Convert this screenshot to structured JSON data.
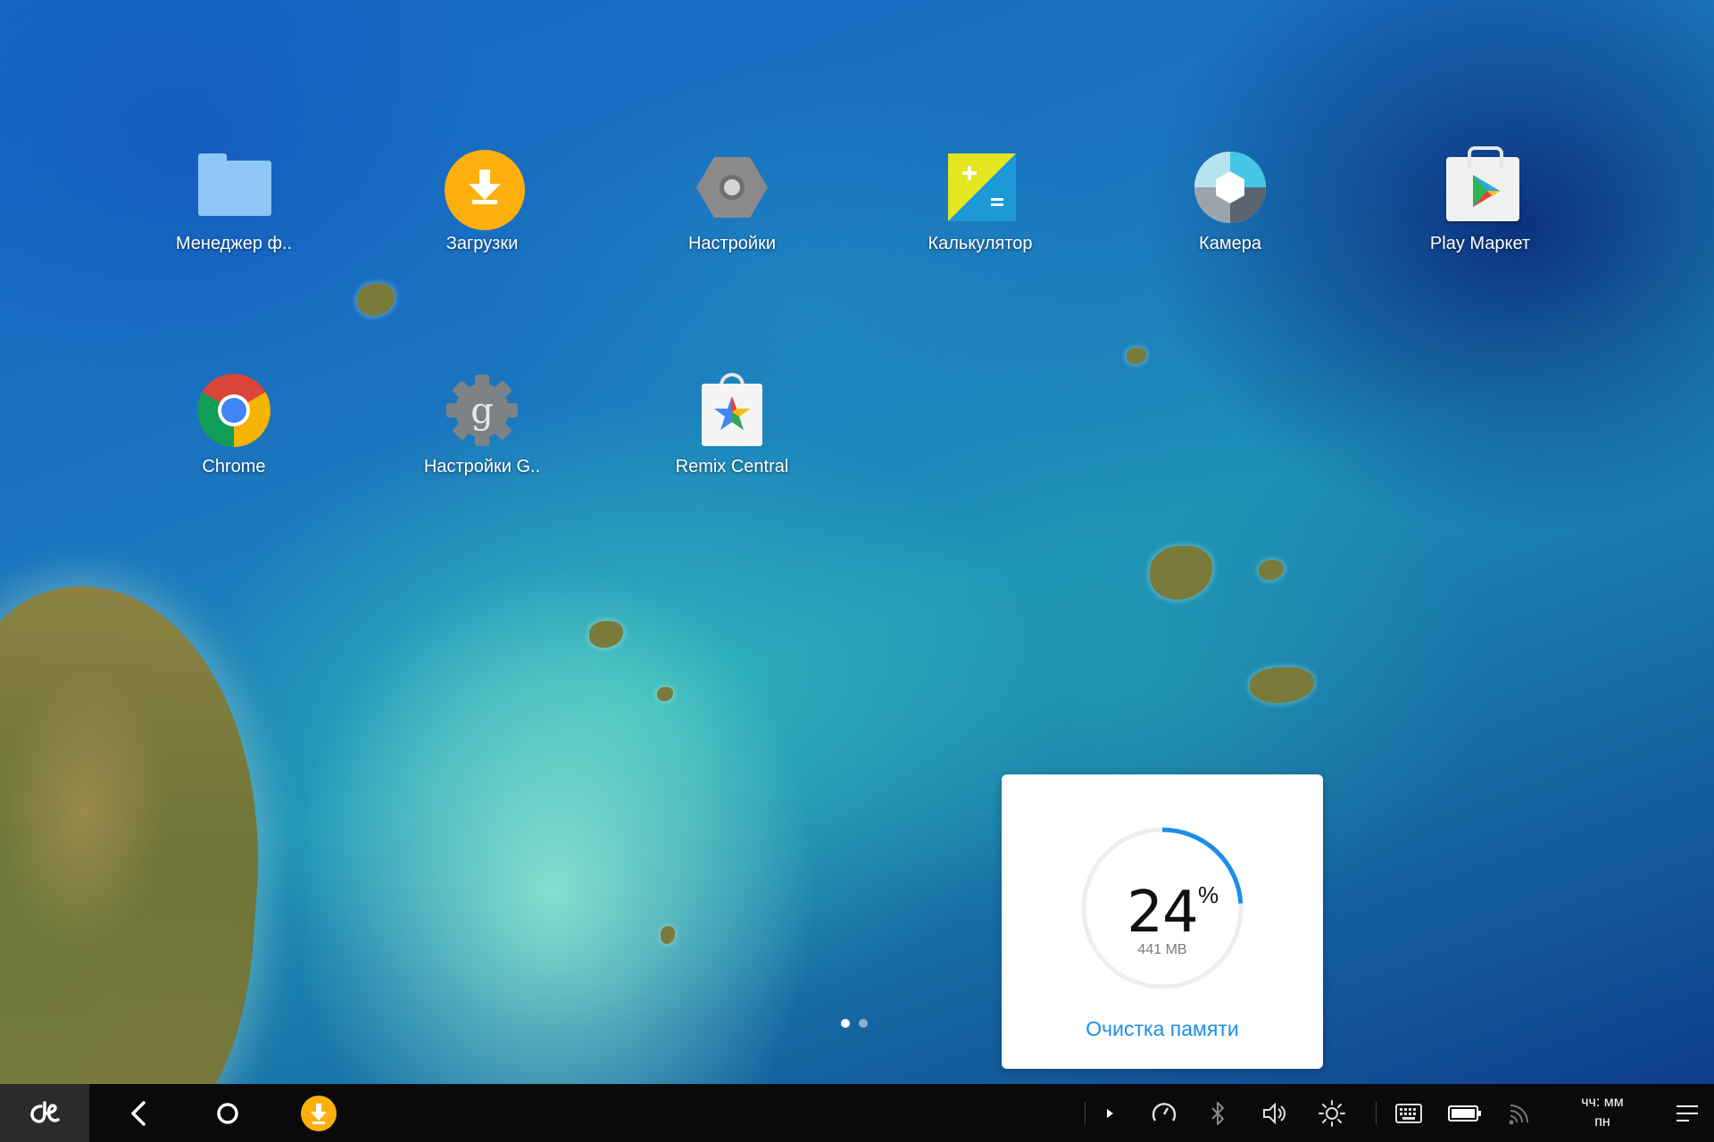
{
  "desktop": {
    "apps_row1": [
      {
        "label": "Менеджер ф..",
        "icon": "folder-icon"
      },
      {
        "label": "Загрузки",
        "icon": "download-icon"
      },
      {
        "label": "Настройки",
        "icon": "settings-icon"
      },
      {
        "label": "Калькулятор",
        "icon": "calculator-icon"
      },
      {
        "label": "Камера",
        "icon": "camera-icon"
      },
      {
        "label": "Play Маркет",
        "icon": "play-store-icon"
      }
    ],
    "apps_row2": [
      {
        "label": "Chrome",
        "icon": "chrome-icon"
      },
      {
        "label": "Настройки G..",
        "icon": "google-settings-icon"
      },
      {
        "label": "Remix Central",
        "icon": "remix-central-icon"
      }
    ],
    "page_indicator": {
      "pages": 2,
      "current": 1
    }
  },
  "memory_widget": {
    "percent": "24",
    "percent_sign": "%",
    "percent_value": 0.24,
    "used": "441 MB",
    "action_label": "Очистка памяти",
    "accent_color": "#1b8ee8"
  },
  "taskbar": {
    "start_icon": "remix-logo-icon",
    "nav": [
      "back-icon",
      "home-icon",
      "download-notification-icon"
    ],
    "tray": [
      "expand-arrow-icon",
      "speed-icon",
      "bluetooth-icon",
      "volume-icon",
      "brightness-icon",
      "keyboard-icon",
      "battery-icon",
      "wifi-icon"
    ],
    "clock_time": "чч: мм",
    "clock_day": "пн",
    "menu_icon": "menu-icon"
  }
}
